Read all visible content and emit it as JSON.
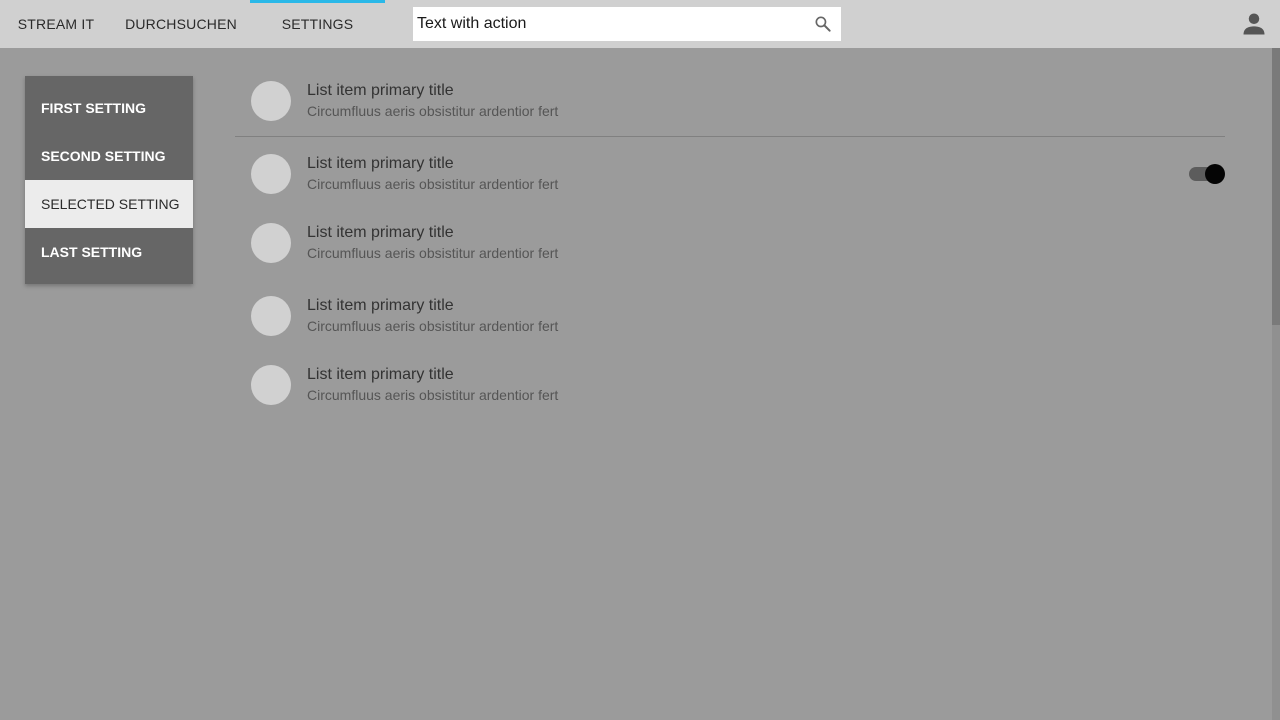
{
  "topbar": {
    "tabs": [
      {
        "label": "STREAM IT"
      },
      {
        "label": "DURCHSUCHEN"
      },
      {
        "label": "SETTINGS",
        "active": true
      }
    ],
    "active_indicator_color": "#2ab8e8",
    "search": {
      "value": "Text with action",
      "icon": "search-icon"
    },
    "account_icon": "account-icon"
  },
  "side_menu": {
    "items": [
      {
        "label": "FIRST SETTING"
      },
      {
        "label": "SECOND SETTING"
      },
      {
        "label": "SELECTED SETTING",
        "selected": true
      },
      {
        "label": "LAST SETTING"
      }
    ]
  },
  "list": {
    "items": [
      {
        "title": "List item primary title",
        "subtitle": "Circumfluus aeris obsistitur ardentior fert"
      },
      {
        "title": "List item primary title",
        "subtitle": "Circumfluus aeris obsistitur ardentior fert",
        "toggle_on": true
      },
      {
        "title": "List item primary title",
        "subtitle": "Circumfluus aeris obsistitur ardentior fert"
      },
      {
        "title": "List item primary title",
        "subtitle": "Circumfluus aeris obsistitur ardentior fert"
      },
      {
        "title": "List item primary title",
        "subtitle": "Circumfluus aeris obsistitur ardentior fert"
      }
    ]
  }
}
